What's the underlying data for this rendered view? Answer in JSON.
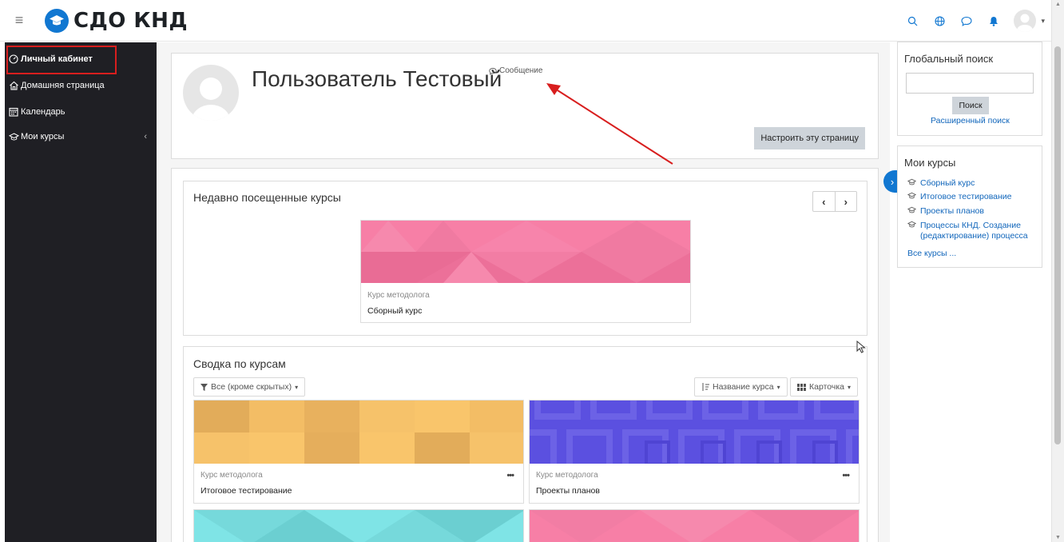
{
  "navbar": {
    "brand_name": "СДО КНД",
    "icons": [
      "menu-icon",
      "graduation-cap-icon",
      "search-icon",
      "globe-icon",
      "chat-bubble-icon",
      "bell-icon",
      "user-avatar-icon",
      "chevron-down-icon"
    ]
  },
  "sidebar": {
    "items": [
      {
        "label": "Личный кабинет",
        "icon": "dashboard-icon",
        "active": true
      },
      {
        "label": "Домашняя страница",
        "icon": "home-icon"
      },
      {
        "label": "Календарь",
        "icon": "calendar-icon"
      },
      {
        "label": "Мои курсы",
        "icon": "graduation-cap-icon"
      }
    ]
  },
  "profile": {
    "name": "Пользователь Тестовый",
    "message_link": "Сообщение",
    "customize_button": "Настроить эту страницу"
  },
  "recent": {
    "title": "Недавно посещенные курсы",
    "prev_glyph": "‹",
    "next_glyph": "›",
    "course": {
      "category": "Курс методолога",
      "name": "Сборный курс",
      "color": "#f77fa6"
    }
  },
  "overview": {
    "title": "Сводка по курсам",
    "filter_label": "Все (кроме скрытых)",
    "sort_label": "Название курса",
    "view_label": "Карточка",
    "more_glyph": "•••",
    "courses": [
      {
        "category": "Курс методолога",
        "name": "Итоговое тестирование",
        "color": "#f9c56b"
      },
      {
        "category": "Курс методолога",
        "name": "Проекты планов",
        "color": "#5b50e0"
      },
      {
        "category": "",
        "name": "",
        "color": "#7fe4e6"
      },
      {
        "category": "",
        "name": "",
        "color": "#f77fa6"
      }
    ]
  },
  "search_block": {
    "title": "Глобальный поиск",
    "input_value": "",
    "button": "Поиск",
    "advanced_link": "Расширенный поиск"
  },
  "my_courses_block": {
    "title": "Мои курсы",
    "items": [
      "Сборный курс",
      "Итоговое тестирование",
      "Проекты планов",
      "Процессы КНД. Создание (редактирование) процесса"
    ],
    "all_courses": "Все курсы ..."
  },
  "colors": {
    "sidebar_bg": "#1f1f24",
    "accent": "#1177d1",
    "link": "#1166bb",
    "annotation": "#d81e1e"
  }
}
